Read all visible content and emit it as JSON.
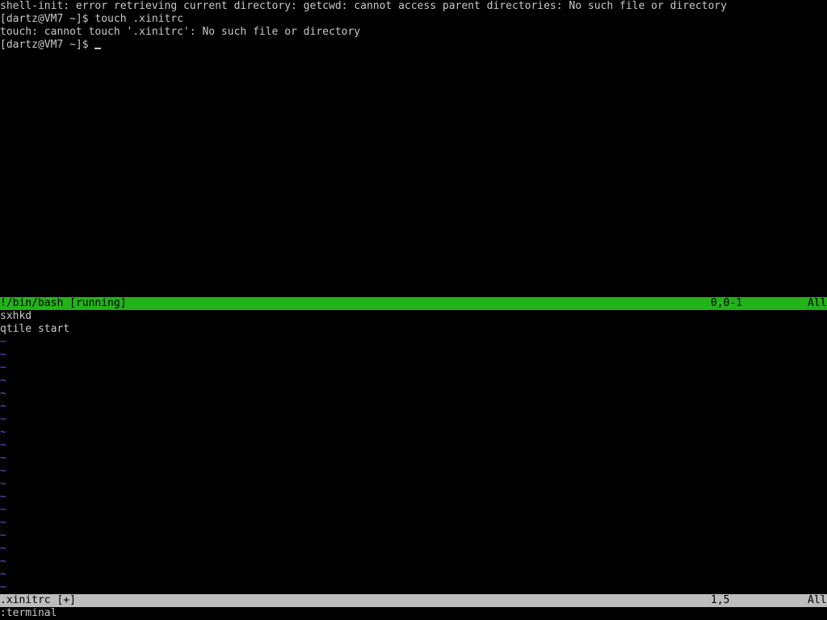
{
  "terminal": {
    "lines": [
      "shell-init: error retrieving current directory: getcwd: cannot access parent directories: No such file or directory",
      "[dartz@VM7 ~]$ touch .xinitrc",
      "touch: cannot touch '.xinitrc': No such file or directory"
    ],
    "prompt": "[dartz@VM7 ~]$ "
  },
  "terminal_status": {
    "name": "!/bin/bash [running]",
    "position": "0,0-1",
    "scroll": "All"
  },
  "editor": {
    "lines": [
      "sxhkd",
      "qtile start"
    ],
    "tilde": "~"
  },
  "editor_status": {
    "name": ".xinitrc [+]",
    "position": "1,5",
    "scroll": "All"
  },
  "command_line": ":terminal",
  "colors": {
    "terminal_status_bg": "#22b318",
    "editor_status_bg": "#bdbdbd",
    "tilde": "#5858f0",
    "text": "#c8c8c8"
  }
}
